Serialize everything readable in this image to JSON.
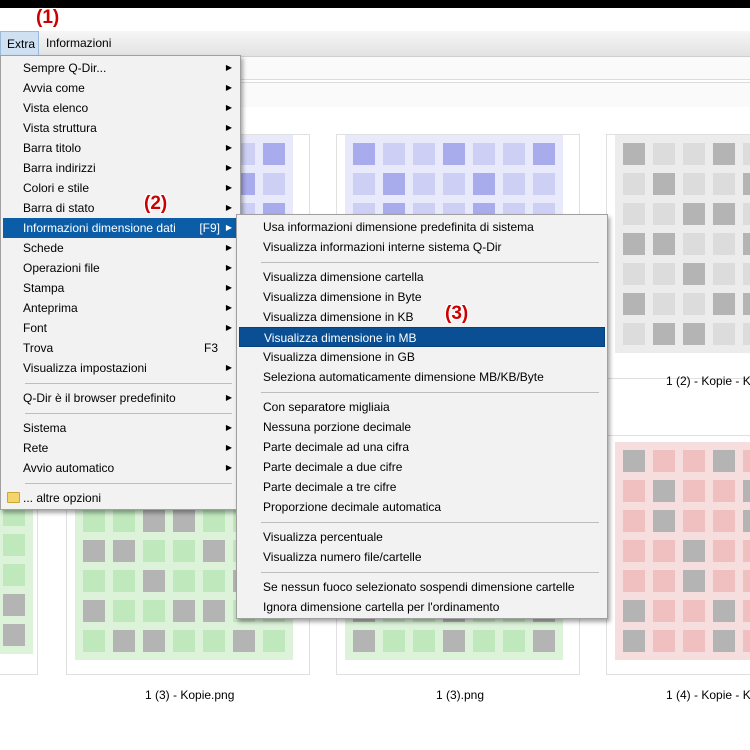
{
  "menubar": {
    "extra": "Extra",
    "informazioni": "Informazioni"
  },
  "badges": {
    "b1": "(1)",
    "b2": "(2)",
    "b3": "(3)"
  },
  "extra_menu": {
    "items": [
      {
        "label": "Sempre Q-Dir...",
        "arrow": true
      },
      {
        "label": "Avvia come",
        "arrow": true
      },
      {
        "label": "Vista elenco",
        "arrow": true
      },
      {
        "label": "Vista struttura",
        "arrow": true
      },
      {
        "label": "Barra titolo",
        "arrow": true
      },
      {
        "label": "Barra indirizzi",
        "arrow": true
      },
      {
        "label": "Colori e stile",
        "arrow": true
      },
      {
        "label": "Barra di stato",
        "arrow": true
      },
      {
        "label": "Informazioni dimensione dati",
        "shortcut": "[F9]",
        "arrow": true,
        "highlighted": true
      },
      {
        "label": "Schede",
        "arrow": true
      },
      {
        "label": "Operazioni file",
        "arrow": true
      },
      {
        "label": "Stampa",
        "arrow": true
      },
      {
        "label": "Anteprima",
        "arrow": true
      },
      {
        "label": "Font",
        "arrow": true
      },
      {
        "label": "Trova",
        "shortcut": "F3"
      },
      {
        "label": "Visualizza impostazioni",
        "arrow": true
      },
      {
        "label": "Q-Dir è il browser predefinito",
        "arrow": true
      },
      {
        "label": "Sistema",
        "arrow": true
      },
      {
        "label": "Rete",
        "arrow": true
      },
      {
        "label": "Avvio automatico",
        "arrow": true
      },
      {
        "label": "... altre opzioni",
        "icon": "folder-icon"
      }
    ]
  },
  "sub_menu": {
    "items": [
      {
        "label": "Usa informazioni dimensione predefinita di sistema"
      },
      {
        "label": "Visualizza informazioni interne sistema Q-Dir"
      },
      {
        "label": "Visualizza dimensione cartella"
      },
      {
        "label": "Visualizza dimensione in Byte"
      },
      {
        "label": "Visualizza dimensione in KB"
      },
      {
        "label": "Visualizza dimensione in MB",
        "highlighted": true
      },
      {
        "label": "Visualizza dimensione in GB"
      },
      {
        "label": "Seleziona automaticamente dimensione MB/KB/Byte"
      },
      {
        "label": "Con separatore migliaia"
      },
      {
        "label": "Nessuna porzione decimale"
      },
      {
        "label": "Parte decimale ad una cifra"
      },
      {
        "label": "Parte decimale a due cifre"
      },
      {
        "label": "Parte decimale a tre cifre"
      },
      {
        "label": "Proporzione decimale automatica"
      },
      {
        "label": "Visualizza percentuale"
      },
      {
        "label": "Visualizza numero file/cartelle"
      },
      {
        "label": "Se nessun fuoco selezionato sospendi dimensione cartelle"
      },
      {
        "label": "Ignora dimensione cartella per l'ordinamento"
      }
    ]
  },
  "files": {
    "captions": [
      "1 (2) - Kopie - K",
      "1 (3) - Kopie.png",
      "1 (3).png",
      "1 (4) - Kopie - K"
    ]
  },
  "colors": {
    "blue_light": "#cdd0f4",
    "blue_dark": "#a8acec",
    "gray_light": "#dcdcdc",
    "gray_dark": "#b4b4b4",
    "green_light": "#bfe8bc",
    "green_dark": "#b4b4b4",
    "red_light": "#f0c0c0",
    "red_dark": "#b4b4b4",
    "highlight": "#0b5da8"
  }
}
